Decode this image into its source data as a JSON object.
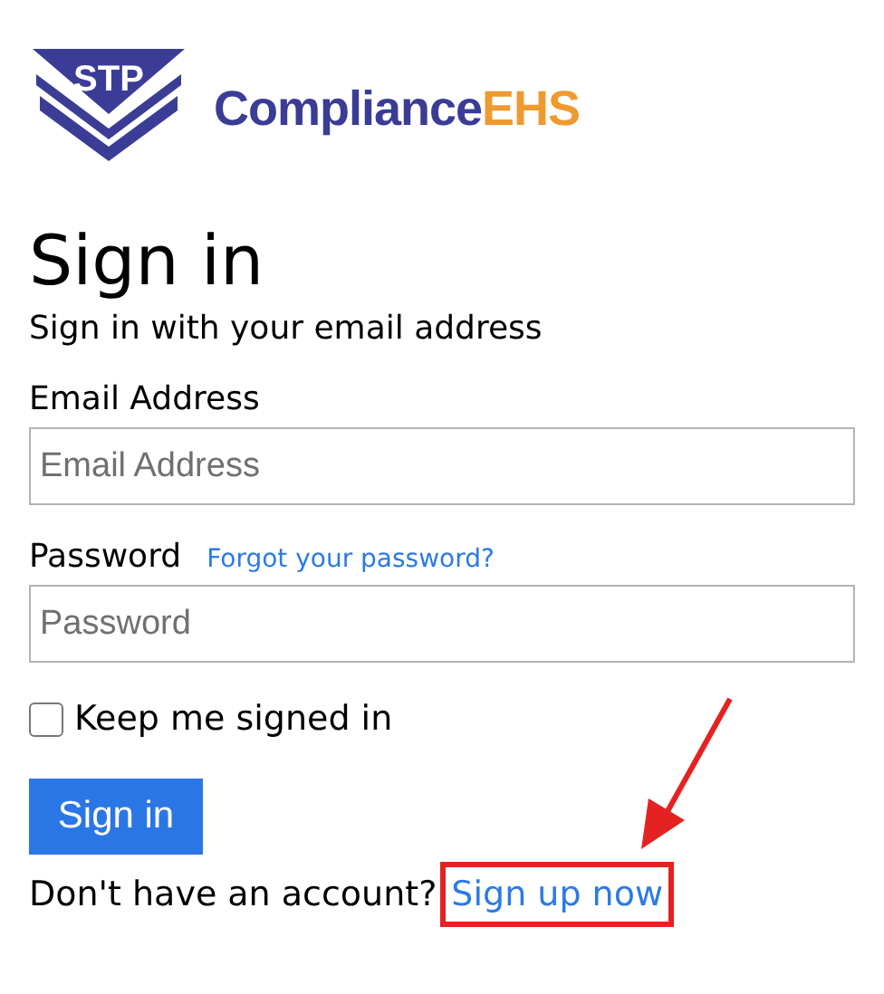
{
  "logo": {
    "badge": "STP",
    "brand_main": "Compliance",
    "brand_accent": "EHS"
  },
  "heading": "Sign in",
  "subtitle": "Sign in with your email address",
  "fields": [
    {
      "label": "Email Address",
      "placeholder": "Email Address"
    },
    {
      "label": "Password",
      "placeholder": "Password",
      "link": "Forgot your password?"
    }
  ],
  "keep_signed_in": {
    "label": "Keep me signed in",
    "checked": false
  },
  "submit": "Sign in",
  "signup": {
    "prompt": "Don't have an account?",
    "link": "Sign up now",
    "highlighted": true
  }
}
